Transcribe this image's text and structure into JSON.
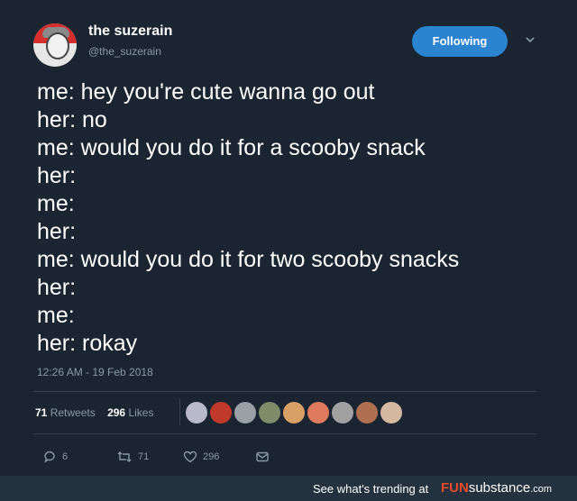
{
  "user": {
    "display_name": "the suzerain",
    "handle": "@the_suzerain"
  },
  "follow_button_label": "Following",
  "tweet_lines": [
    "me: hey you're cute wanna go out",
    "her: no",
    "me: would you do it for a scooby snack",
    "her:",
    "me:",
    "her:",
    "me: would you do it for two scooby snacks",
    "her:",
    "me:",
    "her: rokay"
  ],
  "timestamp": "12:26 AM - 19 Feb 2018",
  "stats": {
    "retweets_count": "71",
    "retweets_label": "Retweets",
    "likes_count": "296",
    "likes_label": "Likes"
  },
  "liker_colors": [
    "#b8b8c8",
    "#c0392b",
    "#9aa0a6",
    "#7f8c6a",
    "#d9a066",
    "#e07a5f",
    "#a0a0a0",
    "#b07050",
    "#d4b8a0"
  ],
  "actions": {
    "reply_count": "6",
    "retweet_count": "71",
    "like_count": "296"
  },
  "footer": {
    "trending_text": "See what's trending at",
    "brand_fun": "FUN",
    "brand_rest": "substance",
    "brand_tld": ".com"
  },
  "colors": {
    "background": "#1b2532",
    "accent": "#2c84d0",
    "muted": "#8899a6",
    "brand": "#e84a2b"
  }
}
